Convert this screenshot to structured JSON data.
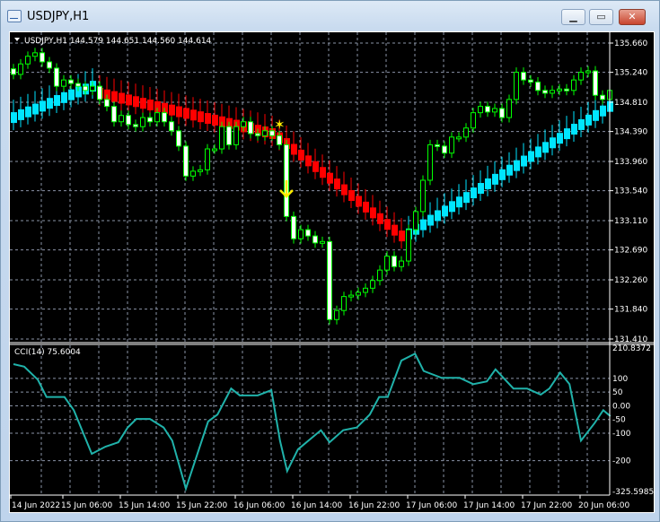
{
  "window": {
    "title": "USDJPY,H1",
    "buttons": {
      "minimize": "minimize-icon",
      "maximize": "maximize-icon",
      "close": "close-icon"
    }
  },
  "chart": {
    "header": "USDJPY,H1  144.579 144.651 144.560 144.614",
    "colors": {
      "background": "#000000",
      "grid": "#8a93a6",
      "bull_outline": "#00ff00",
      "bear_body": "#ffffff",
      "overlay_up": "#00e5ff",
      "overlay_down": "#ff0000",
      "marker": "#ffee00",
      "cci": "#20b2aa"
    },
    "price_axis": [
      "135.660",
      "135.240",
      "134.810",
      "134.390",
      "133.960",
      "133.540",
      "133.110",
      "132.690",
      "132.260",
      "131.840",
      "131.410"
    ],
    "price_range": [
      131.41,
      135.66
    ],
    "time_axis": [
      "14 Jun 2022",
      "15 Jun 06:00",
      "15 Jun 14:00",
      "15 Jun 22:00",
      "16 Jun 06:00",
      "16 Jun 14:00",
      "16 Jun 22:00",
      "17 Jun 06:00",
      "17 Jun 14:00",
      "17 Jun 22:00",
      "20 Jun 06:00"
    ],
    "closes": [
      135.21,
      135.36,
      135.47,
      135.52,
      135.39,
      135.3,
      135.04,
      135.13,
      135.08,
      135.04,
      134.98,
      135.04,
      134.85,
      134.75,
      134.53,
      134.62,
      134.49,
      134.46,
      134.59,
      134.53,
      134.66,
      134.53,
      134.4,
      134.18,
      133.75,
      133.82,
      133.84,
      134.14,
      134.14,
      134.46,
      134.2,
      134.46,
      134.53,
      134.36,
      134.33,
      134.4,
      134.33,
      134.2,
      133.17,
      132.85,
      132.98,
      132.89,
      132.79,
      132.81,
      131.69,
      131.82,
      132.02,
      132.04,
      132.08,
      132.14,
      132.25,
      132.4,
      132.6,
      132.45,
      132.53,
      132.98,
      133.24,
      133.69,
      134.2,
      134.18,
      134.08,
      134.31,
      134.31,
      134.44,
      134.66,
      134.75,
      134.67,
      134.72,
      134.59,
      134.85,
      135.24,
      135.13,
      135.1,
      134.98,
      134.94,
      134.98,
      135.0,
      134.98,
      135.13,
      135.24,
      135.26,
      134.91,
      134.85,
      134.98
    ],
    "overlay": [
      {
        "trend": "up",
        "from": 0,
        "to": 11,
        "start": 134.59,
        "end": 135.04
      },
      {
        "trend": "down",
        "from": 12,
        "to": 36,
        "start": 134.94,
        "end": 134.36
      },
      {
        "trend": "down",
        "from": 37,
        "to": 54,
        "start": 134.3,
        "end": 132.89
      },
      {
        "trend": "up",
        "from": 55,
        "to": 83,
        "start": 132.92,
        "end": 134.75
      }
    ],
    "markers": [
      {
        "type": "star-icon",
        "candle": 37,
        "price": 134.49
      },
      {
        "type": "arrow-down-icon",
        "candle": 38,
        "price": 133.56
      }
    ]
  },
  "cci": {
    "label": "CCI(14) 75.6004",
    "axis": [
      "210.8372",
      "100",
      "50",
      "0.00",
      "-50",
      "-100",
      "-200",
      "-325.5985"
    ],
    "axis_values": [
      210.8372,
      100,
      50,
      0,
      -50,
      -100,
      -200,
      -325.5985
    ],
    "range": [
      -325.5985,
      210.8372
    ],
    "points": [
      [
        0,
        152
      ],
      [
        1.5,
        143
      ],
      [
        3.4,
        95
      ],
      [
        4.6,
        32
      ],
      [
        5.9,
        32
      ],
      [
        7.1,
        32
      ],
      [
        8.4,
        -16
      ],
      [
        10.9,
        -175
      ],
      [
        12.8,
        -149
      ],
      [
        14.6,
        -133
      ],
      [
        15.9,
        -79
      ],
      [
        17.1,
        -48
      ],
      [
        19,
        -48
      ],
      [
        20.9,
        -79
      ],
      [
        22.1,
        -127
      ],
      [
        24,
        -302
      ],
      [
        27.1,
        -57
      ],
      [
        28.4,
        -32
      ],
      [
        30.3,
        63
      ],
      [
        31.5,
        38
      ],
      [
        34,
        38
      ],
      [
        35.9,
        57
      ],
      [
        37.1,
        -127
      ],
      [
        38.1,
        -238
      ],
      [
        39.6,
        -159
      ],
      [
        42.8,
        -89
      ],
      [
        44,
        -133
      ],
      [
        45.9,
        -89
      ],
      [
        47.8,
        -79
      ],
      [
        49.6,
        -32
      ],
      [
        50.9,
        32
      ],
      [
        52.1,
        32
      ],
      [
        54,
        165
      ],
      [
        55.9,
        190
      ],
      [
        57.1,
        127
      ],
      [
        59.6,
        102
      ],
      [
        62.1,
        102
      ],
      [
        64,
        79
      ],
      [
        65.9,
        89
      ],
      [
        67.1,
        133
      ],
      [
        69.6,
        63
      ],
      [
        71.5,
        63
      ],
      [
        73.4,
        41
      ],
      [
        74.6,
        63
      ],
      [
        76.1,
        121
      ],
      [
        77.4,
        79
      ],
      [
        79,
        -127
      ],
      [
        80.9,
        -63
      ],
      [
        82.1,
        -16
      ],
      [
        83.1,
        -38
      ]
    ]
  }
}
